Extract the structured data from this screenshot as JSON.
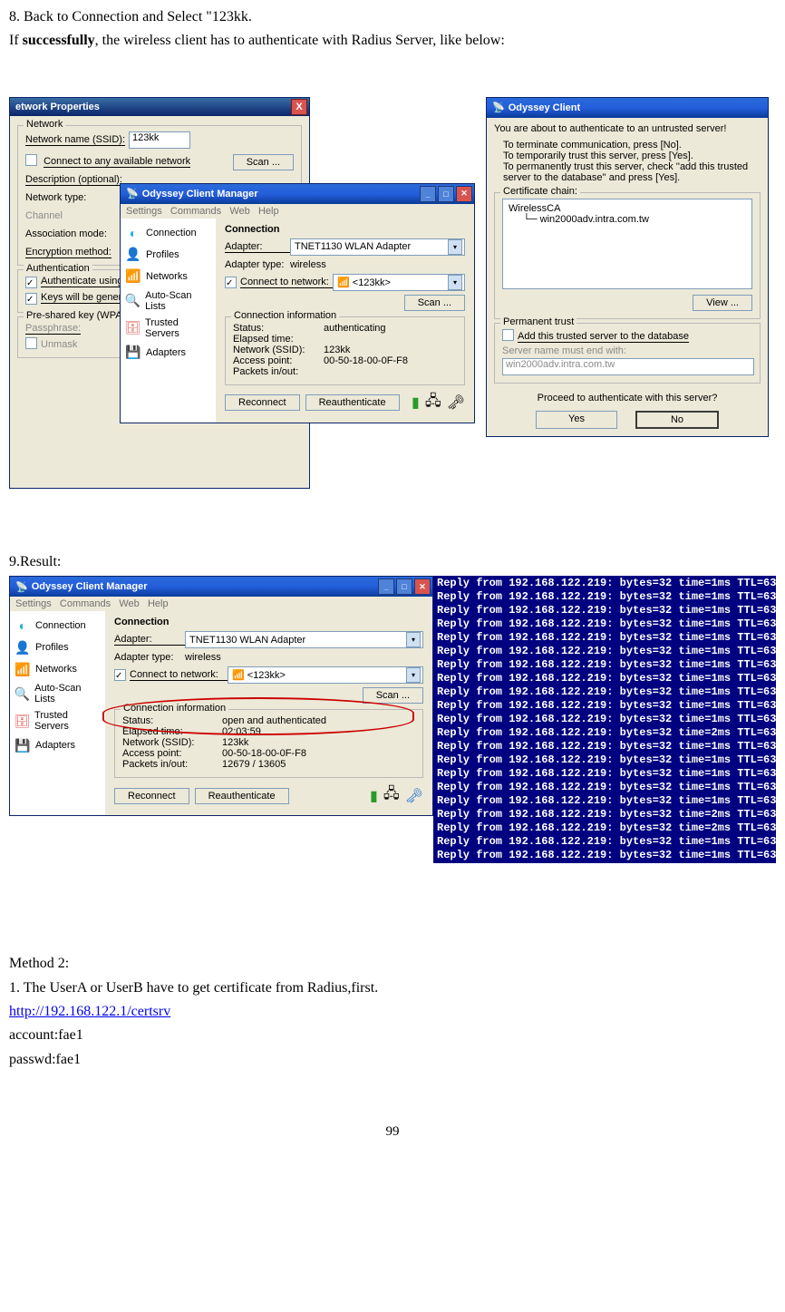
{
  "text": {
    "t1": "8. Back to Connection and Select \"123kk.",
    "t2a": "If ",
    "t2b": "successfully",
    "t2c": ", the wireless client has to authenticate with Radius Server, like below:",
    "t3": "9.Result:",
    "m2": "Method 2:",
    "m2_1": "1. The UserA or UserB have to get certificate from Radius,first.",
    "m2_url": "http://192.168.122.1/certsrv",
    "m2_acc": "account:fae1",
    "m2_pwd": "passwd:fae1",
    "page": "99"
  },
  "fig1": {
    "netprops": {
      "title": "etwork Properties",
      "close": "X",
      "grp_network": "Network",
      "lbl_name": "Network name (SSID):",
      "val_name": "123kk",
      "chk_any": "Connect to any available network",
      "btn_scan": "Scan ...",
      "lbl_desc": "Description (optional):",
      "lbl_type": "Network type:",
      "lbl_channel": "Channel",
      "lbl_assoc": "Association mode:",
      "lbl_enc": "Encryption method:",
      "grp_auth": "Authentication",
      "chk_auth": "Authenticate using",
      "chk_keys": "Keys will be genera",
      "grp_psk": "Pre-shared key (WPA)",
      "lbl_pass": "Passphrase:",
      "chk_unmask": "Unmask"
    },
    "odyssey": {
      "title": "Odyssey Client Manager",
      "menu": {
        "s": "Settings",
        "c": "Commands",
        "w": "Web",
        "h": "Help"
      },
      "side": {
        "conn": "Connection",
        "prof": "Profiles",
        "net": "Networks",
        "auto": "Auto-Scan Lists",
        "trust": "Trusted Servers",
        "adap": "Adapters"
      },
      "hd": "Connection",
      "lbl_adapter": "Adapter:",
      "val_adapter": "TNET1130 WLAN Adapter",
      "lbl_atype": "Adapter type:",
      "val_atype": "wireless",
      "chk_connect": "Connect to network:",
      "val_network": "<123kk>",
      "btn_scan": "Scan ...",
      "grp_info": "Connection information",
      "lbl_status": "Status:",
      "val_status": "authenticating",
      "lbl_elapsed": "Elapsed time:",
      "val_elapsed": "",
      "lbl_ssid": "Network (SSID):",
      "val_ssid": "123kk",
      "lbl_ap": "Access point:",
      "val_ap": "00-50-18-00-0F-F8",
      "lbl_pio": "Packets in/out:",
      "val_pio": "",
      "btn_reconnect": "Reconnect",
      "btn_reauth": "Reauthenticate"
    },
    "dlg": {
      "title": "Odyssey Client",
      "line1": "You are about to authenticate to an untrusted server!",
      "line2": "To terminate communication, press [No].",
      "line3": "To temporarily trust this server, press [Yes].",
      "line4": "To permanently trust this server, check ''add this trusted server to the database'' and press [Yes].",
      "grp_chain": "Certificate chain:",
      "tree1": "WirelessCA",
      "tree2": "win2000adv.intra.com.tw",
      "btn_view": "View ...",
      "grp_perm": "Permanent trust",
      "chk_add": "Add this trusted server to the database",
      "lbl_end": "Server name must end with:",
      "val_end": "win2000adv.intra.com.tw",
      "prompt": "Proceed to authenticate with this server?",
      "btn_yes": "Yes",
      "btn_no": "No"
    }
  },
  "fig2": {
    "odyssey": {
      "title": "Odyssey Client Manager",
      "menu": {
        "s": "Settings",
        "c": "Commands",
        "w": "Web",
        "h": "Help"
      },
      "side": {
        "conn": "Connection",
        "prof": "Profiles",
        "net": "Networks",
        "auto": "Auto-Scan Lists",
        "trust": "Trusted Servers",
        "adap": "Adapters"
      },
      "hd": "Connection",
      "lbl_adapter": "Adapter:",
      "val_adapter": "TNET1130 WLAN Adapter",
      "lbl_atype": "Adapter type:",
      "val_atype": "wireless",
      "chk_connect": "Connect to network:",
      "val_network": "<123kk>",
      "btn_scan": "Scan ...",
      "grp_info": "Connection information",
      "lbl_status": "Status:",
      "val_status": "open and authenticated",
      "lbl_elapsed": "Elapsed time:",
      "val_elapsed": "02:03:59",
      "lbl_ssid": "Network (SSID):",
      "val_ssid": "123kk",
      "lbl_ap": "Access point:",
      "val_ap": "00-50-18-00-0F-F8",
      "lbl_pio": "Packets in/out:",
      "val_pio": "12679 / 13605",
      "btn_reconnect": "Reconnect",
      "btn_reauth": "Reauthenticate"
    },
    "ping": {
      "host": "192.168.122.219",
      "bytes": "32",
      "ttl": "63",
      "times": [
        "1ms",
        "1ms",
        "1ms",
        "1ms",
        "1ms",
        "1ms",
        "1ms",
        "1ms",
        "1ms",
        "1ms",
        "1ms",
        "2ms",
        "1ms",
        "1ms",
        "1ms",
        "1ms",
        "1ms",
        "2ms",
        "2ms",
        "1ms",
        "1ms"
      ]
    }
  }
}
